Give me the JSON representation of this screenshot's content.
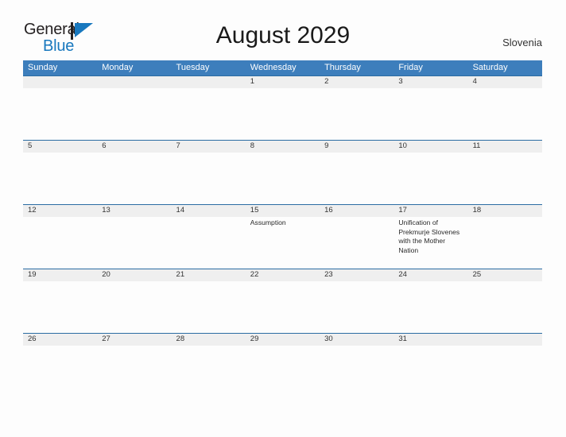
{
  "brand": {
    "name_part1": "General",
    "name_part2": "Blue",
    "flag_icon": "blue-triangle-flag-icon",
    "colors": {
      "dark": "#231f20",
      "blue": "#1878be"
    }
  },
  "header": {
    "title": "August 2029",
    "country": "Slovenia"
  },
  "theme": {
    "header_blue": "#3d7ebc",
    "band_gray": "#efefef",
    "band_border": "#2b6ca3",
    "page_background": "#fdfdfd"
  },
  "calendar": {
    "month": "August",
    "year": "2029",
    "weekday_headers": [
      "Sunday",
      "Monday",
      "Tuesday",
      "Wednesday",
      "Thursday",
      "Friday",
      "Saturday"
    ],
    "weeks": [
      [
        {
          "day": "",
          "event": ""
        },
        {
          "day": "",
          "event": ""
        },
        {
          "day": "",
          "event": ""
        },
        {
          "day": "1",
          "event": ""
        },
        {
          "day": "2",
          "event": ""
        },
        {
          "day": "3",
          "event": ""
        },
        {
          "day": "4",
          "event": ""
        }
      ],
      [
        {
          "day": "5",
          "event": ""
        },
        {
          "day": "6",
          "event": ""
        },
        {
          "day": "7",
          "event": ""
        },
        {
          "day": "8",
          "event": ""
        },
        {
          "day": "9",
          "event": ""
        },
        {
          "day": "10",
          "event": ""
        },
        {
          "day": "11",
          "event": ""
        }
      ],
      [
        {
          "day": "12",
          "event": ""
        },
        {
          "day": "13",
          "event": ""
        },
        {
          "day": "14",
          "event": ""
        },
        {
          "day": "15",
          "event": "Assumption"
        },
        {
          "day": "16",
          "event": ""
        },
        {
          "day": "17",
          "event": "Unification of Prekmurje Slovenes with the Mother Nation"
        },
        {
          "day": "18",
          "event": ""
        }
      ],
      [
        {
          "day": "19",
          "event": ""
        },
        {
          "day": "20",
          "event": ""
        },
        {
          "day": "21",
          "event": ""
        },
        {
          "day": "22",
          "event": ""
        },
        {
          "day": "23",
          "event": ""
        },
        {
          "day": "24",
          "event": ""
        },
        {
          "day": "25",
          "event": ""
        }
      ],
      [
        {
          "day": "26",
          "event": ""
        },
        {
          "day": "27",
          "event": ""
        },
        {
          "day": "28",
          "event": ""
        },
        {
          "day": "29",
          "event": ""
        },
        {
          "day": "30",
          "event": ""
        },
        {
          "day": "31",
          "event": ""
        },
        {
          "day": "",
          "event": ""
        }
      ]
    ]
  }
}
